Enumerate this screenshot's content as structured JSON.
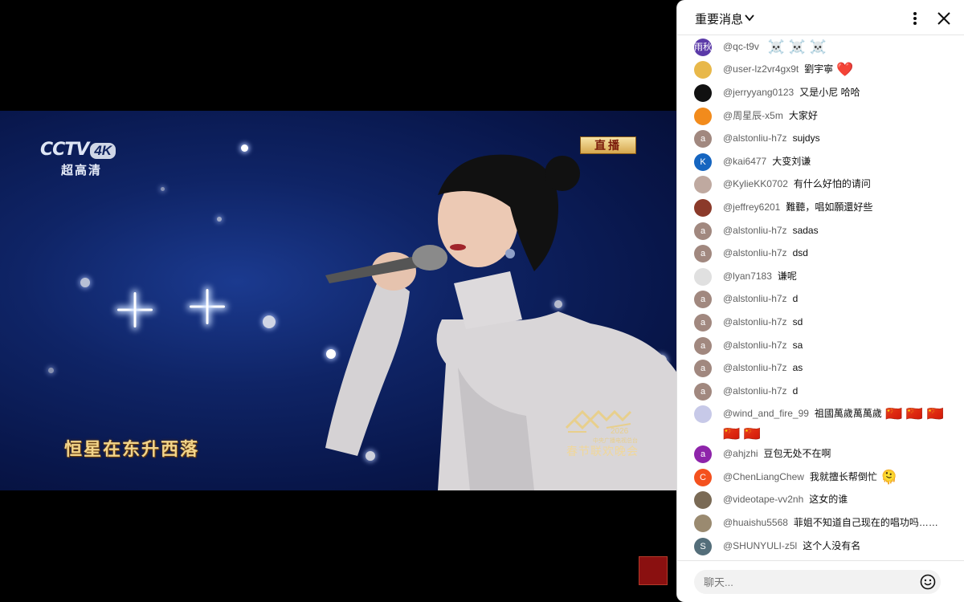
{
  "video": {
    "channel_logo": "CCTV",
    "channel_badge": "4K",
    "channel_sub": "超高清",
    "live_badge": "直播",
    "lyric": "恒星在东升西落",
    "gala_year": "2026",
    "gala_sub": "中央广播电视总台",
    "gala_title": "春节联欢晚会"
  },
  "chat": {
    "header_title": "重要消息",
    "input_placeholder": "聊天...",
    "messages": [
      {
        "author": "@qc-t9v",
        "text": "",
        "emoji": "☠️ ☠️ ☠️",
        "avatar_text": "雨秋",
        "avatar_color": "#5b3aa8"
      },
      {
        "author": "@user-lz2vr4gx9t",
        "text": "劉宇寧",
        "emoji": "❤️",
        "avatar_text": "",
        "avatar_color": "#e8b84a"
      },
      {
        "author": "@jerryyang0123",
        "text": "又是小尼 哈哈",
        "emoji": "",
        "avatar_text": "",
        "avatar_color": "#111111"
      },
      {
        "author": "@周星辰-x5m",
        "text": "大家好",
        "emoji": "",
        "avatar_text": "",
        "avatar_color": "#f28b1c"
      },
      {
        "author": "@alstonliu-h7z",
        "text": "sujdys",
        "emoji": "",
        "avatar_text": "a",
        "avatar_color": "#a1887f"
      },
      {
        "author": "@kai6477",
        "text": "大变刘谦",
        "emoji": "",
        "avatar_text": "K",
        "avatar_color": "#1565c0"
      },
      {
        "author": "@KylieKK0702",
        "text": "有什么好怕的请问",
        "emoji": "",
        "avatar_text": "",
        "avatar_color": "#bfa9a0"
      },
      {
        "author": "@jeffrey6201",
        "text": "難聽，唱如願還好些",
        "emoji": "",
        "avatar_text": "",
        "avatar_color": "#8b3a2a"
      },
      {
        "author": "@alstonliu-h7z",
        "text": "sadas",
        "emoji": "",
        "avatar_text": "a",
        "avatar_color": "#a1887f"
      },
      {
        "author": "@alstonliu-h7z",
        "text": "dsd",
        "emoji": "",
        "avatar_text": "a",
        "avatar_color": "#a1887f"
      },
      {
        "author": "@lyan7183",
        "text": "谦呢",
        "emoji": "",
        "avatar_text": "",
        "avatar_color": "#e0e0e0"
      },
      {
        "author": "@alstonliu-h7z",
        "text": "d",
        "emoji": "",
        "avatar_text": "a",
        "avatar_color": "#a1887f"
      },
      {
        "author": "@alstonliu-h7z",
        "text": "sd",
        "emoji": "",
        "avatar_text": "a",
        "avatar_color": "#a1887f"
      },
      {
        "author": "@alstonliu-h7z",
        "text": "sa",
        "emoji": "",
        "avatar_text": "a",
        "avatar_color": "#a1887f"
      },
      {
        "author": "@alstonliu-h7z",
        "text": "as",
        "emoji": "",
        "avatar_text": "a",
        "avatar_color": "#a1887f"
      },
      {
        "author": "@alstonliu-h7z",
        "text": "d",
        "emoji": "",
        "avatar_text": "a",
        "avatar_color": "#a1887f"
      },
      {
        "author": "@wind_and_fire_99",
        "text": "祖國萬歲萬萬歲",
        "emoji": "🇨🇳 🇨🇳 🇨🇳 🇨🇳 🇨🇳",
        "avatar_text": "",
        "avatar_color": "#c7c9e8"
      },
      {
        "author": "@ahjzhi",
        "text": "豆包无处不在啊",
        "emoji": "",
        "avatar_text": "a",
        "avatar_color": "#8e24aa"
      },
      {
        "author": "@ChenLiangChew",
        "text": "我就擅长帮倒忙",
        "emoji": "🫠",
        "avatar_text": "C",
        "avatar_color": "#f4511e"
      },
      {
        "author": "@videotape-vv2nh",
        "text": "这女的谁",
        "emoji": "",
        "avatar_text": "",
        "avatar_color": "#7a6a55"
      },
      {
        "author": "@huaishu5568",
        "text": "菲姐不知道自己现在的唱功吗……",
        "emoji": "",
        "avatar_text": "",
        "avatar_color": "#9a8a70"
      },
      {
        "author": "@SHUNYULI-z5l",
        "text": "这个人没有名",
        "emoji": "",
        "avatar_text": "S",
        "avatar_color": "#546e7a"
      }
    ]
  }
}
